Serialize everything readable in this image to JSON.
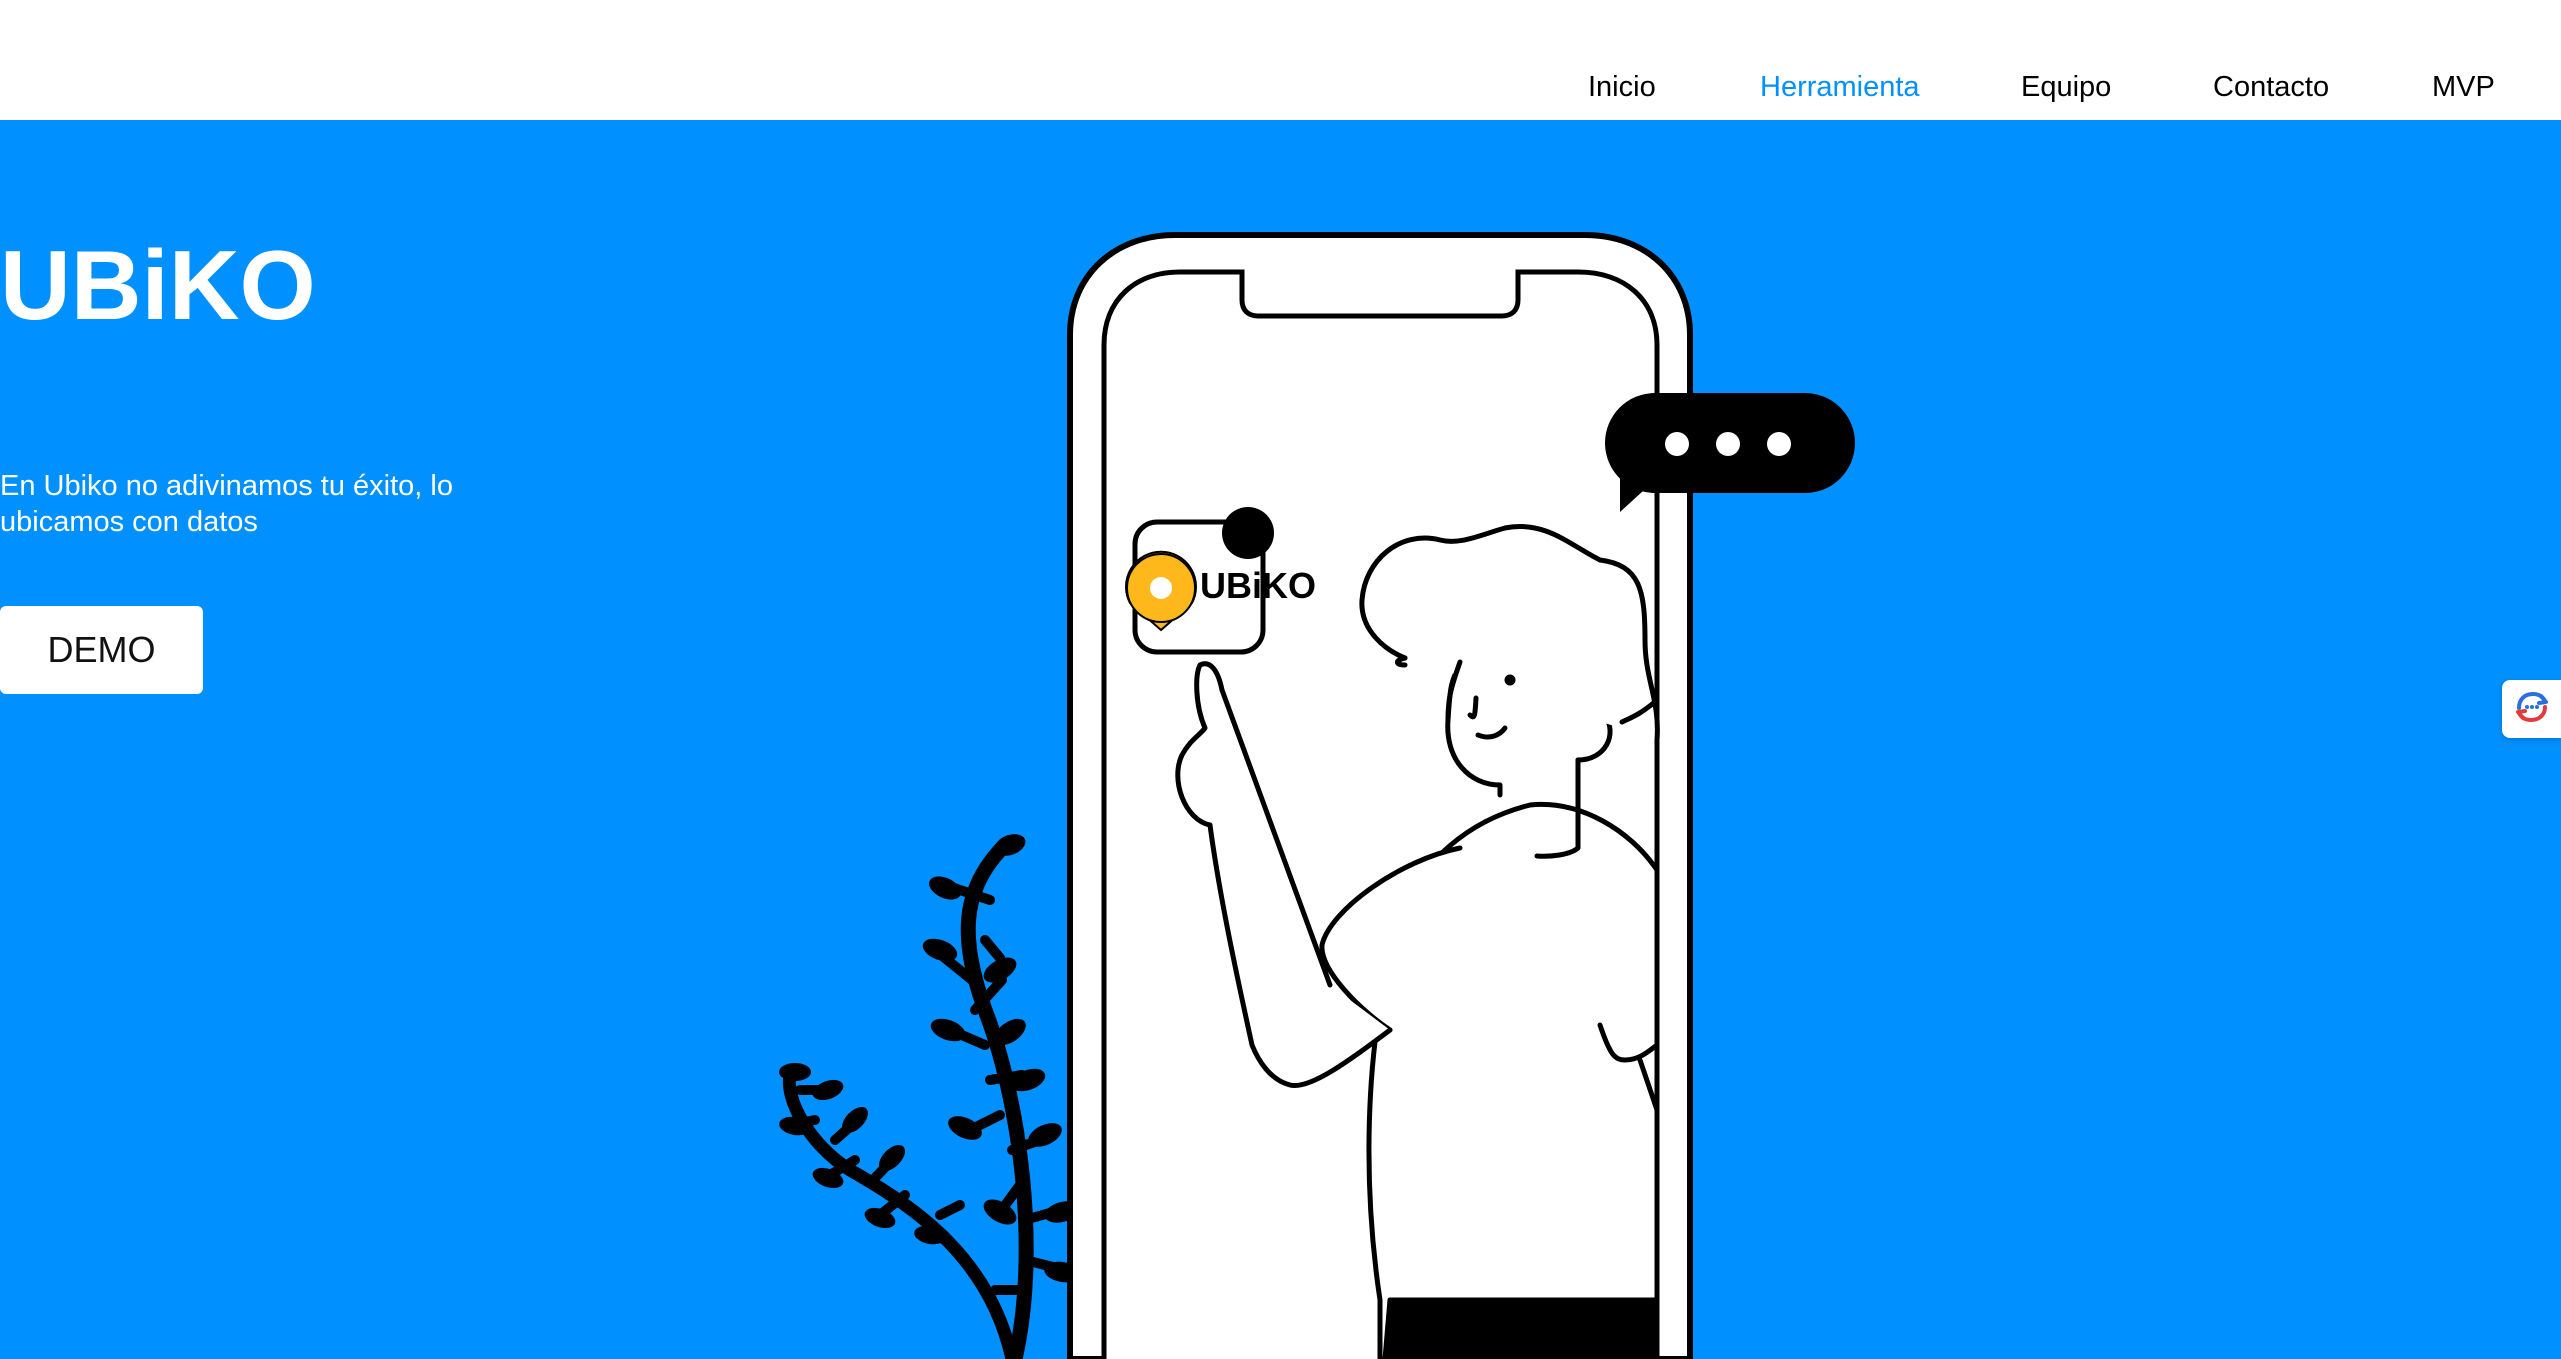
{
  "nav": {
    "items": [
      {
        "label": "Inicio",
        "active": false
      },
      {
        "label": "Herramienta",
        "active": true
      },
      {
        "label": "Equipo",
        "active": false
      },
      {
        "label": "Contacto",
        "active": false
      },
      {
        "label": "MVP",
        "active": false
      }
    ]
  },
  "hero": {
    "title": "UBiKO",
    "tagline": "En Ubiko no adivinamos tu éxito, lo ubicamos con datos",
    "cta_label": "DEMO"
  },
  "illustration": {
    "app_icon_label": "UBiKO",
    "icons": [
      "phone-illustration",
      "chat-bubble-icon",
      "map-pin-icon",
      "plant-illustration",
      "person-illustration"
    ]
  },
  "side_widget": {
    "icon": "translate-chat-icon"
  },
  "colors": {
    "primary": "#0090ff",
    "nav_active": "#0090ff",
    "white": "#ffffff",
    "ink": "#000000",
    "pin": "#ffb81c"
  }
}
